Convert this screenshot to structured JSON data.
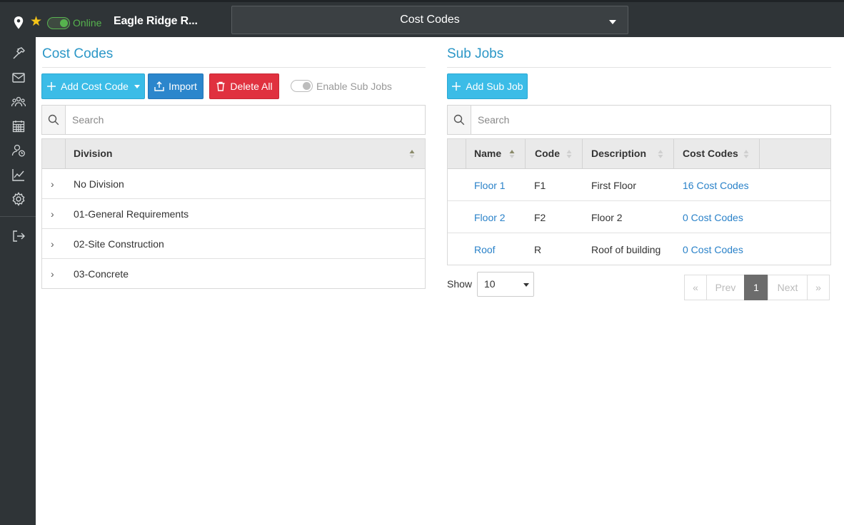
{
  "topbar": {
    "status_label": "Online",
    "project_name": "Eagle Ridge R...",
    "page_selector": "Cost Codes"
  },
  "sidebar": {
    "items": [
      {
        "icon": "hammer-icon"
      },
      {
        "icon": "mail-icon"
      },
      {
        "icon": "users-icon"
      },
      {
        "icon": "calendar-icon"
      },
      {
        "icon": "user-clock-icon"
      },
      {
        "icon": "chart-icon"
      },
      {
        "icon": "gear-icon"
      },
      {
        "icon": "logout-icon"
      }
    ]
  },
  "cost_codes": {
    "title": "Cost Codes",
    "add_button": "Add Cost Code",
    "import_button": "Import",
    "delete_button": "Delete All",
    "toggle_label": "Enable Sub Jobs",
    "search_placeholder": "Search",
    "column_header": "Division",
    "divisions": [
      "No Division",
      "01-General Requirements",
      "02-Site Construction",
      "03-Concrete"
    ]
  },
  "sub_jobs": {
    "title": "Sub Jobs",
    "add_button": "Add Sub Job",
    "search_placeholder": "Search",
    "columns": [
      "Name",
      "Code",
      "Description",
      "Cost Codes"
    ],
    "rows": [
      {
        "name": "Floor 1",
        "code": "F1",
        "description": "First Floor",
        "cost_codes": "16 Cost Codes"
      },
      {
        "name": "Floor 2",
        "code": "F2",
        "description": "Floor 2",
        "cost_codes": "0 Cost Codes"
      },
      {
        "name": "Roof",
        "code": "R",
        "description": "Roof of building",
        "cost_codes": "0 Cost Codes"
      }
    ],
    "show_label": "Show",
    "page_size": "10",
    "pagination": {
      "first": "«",
      "prev": "Prev",
      "current": "1",
      "next": "Next",
      "last": "»"
    }
  },
  "colors": {
    "accent": "#2c97c7",
    "info": "#3bbce7",
    "primary": "#2b86cc",
    "danger": "#e0313f",
    "online": "#56b34e"
  }
}
